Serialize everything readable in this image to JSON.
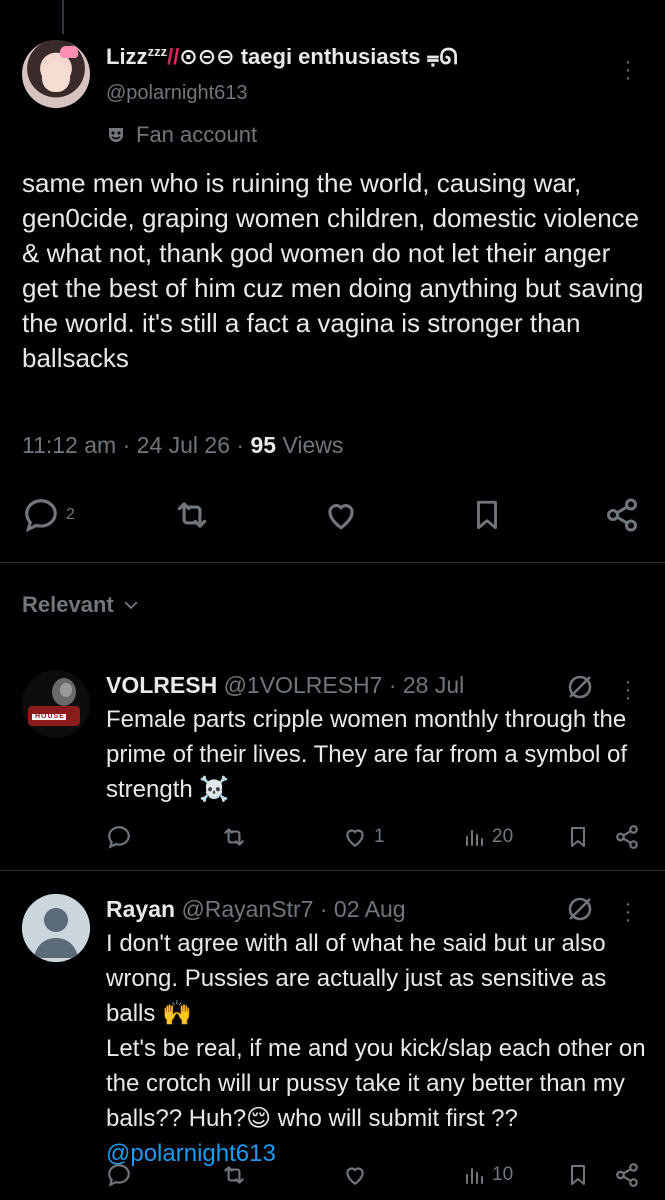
{
  "main_tweet": {
    "display_name": "Lizzᶻᶻᶻ⸝⸝◌◌◌ taegi enthusiasts ⭍",
    "display_name_visible": "Lizz₂ᶻᶻ ⫫ ◉◉⊝ taegi enthusiasts ⩯ᴏ",
    "handle": "@polarnight613",
    "label": "Fan account",
    "text": "same men who is ruining the world, causing war, gen0cide, graping women children, domestic violence & what not, thank god women do not let their anger get the best of him cuz men doing anything but saving the world. it's still a fact a vagina is stronger than ballsacks",
    "time": "11:12 am",
    "date": "24 Jul 26",
    "views_count": "95",
    "views_label": "Views",
    "reply_count": "2",
    "icons": [
      "reply-icon",
      "retweet-icon",
      "like-icon",
      "bookmark-icon",
      "share-icon"
    ]
  },
  "sort": {
    "label": "Relevant"
  },
  "replies": [
    {
      "name": "VOLRESH",
      "handle": "@1VOLRESH7",
      "date": "28 Jul",
      "avatar_text": "HOUSE",
      "text": "Female parts cripple women monthly through the prime of their lives. They are far from a symbol of strength ☠️",
      "likes": "1",
      "views": "20"
    },
    {
      "name": "Rayan",
      "handle": "@RayanStr7",
      "date": "02 Aug",
      "text_lines": [
        "I don't agree with all of what he said but ur also wrong. Pussies are actually just as sensitive as balls 🙌",
        "Let's be real, if me and you kick/slap each other on the crotch will ur pussy take it any better than my balls?? Huh?😌 who will submit first ?? "
      ],
      "mention": "@polarnight613",
      "views": "10"
    }
  ],
  "colors": {
    "background": "#000000",
    "text": "#e7e9ea",
    "secondary": "#71767b",
    "link": "#1d9bf0",
    "divider": "#2f3336"
  }
}
